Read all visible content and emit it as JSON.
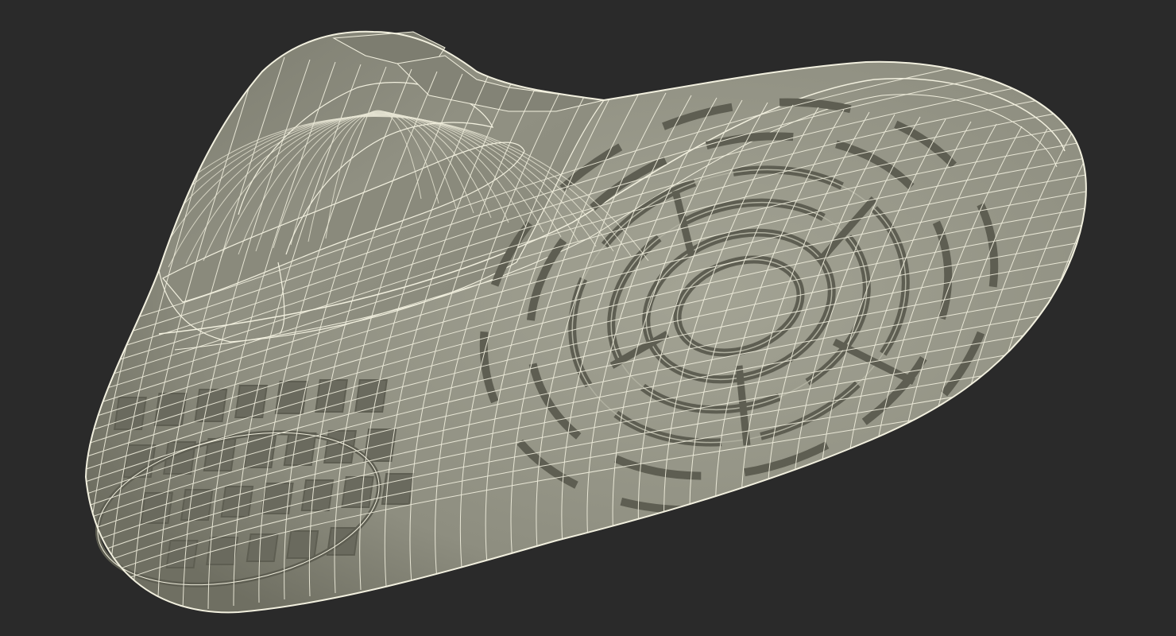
{
  "scene": {
    "subject": "sneaker-wireframe-render",
    "view": "underside",
    "colors": {
      "background": "#2a2a2a",
      "surface": "#8e8e80",
      "surface_light": "#a3a394",
      "surface_dark": "#6f6f62",
      "groove": "#5e5e52",
      "wire": "#f2f0df"
    }
  }
}
